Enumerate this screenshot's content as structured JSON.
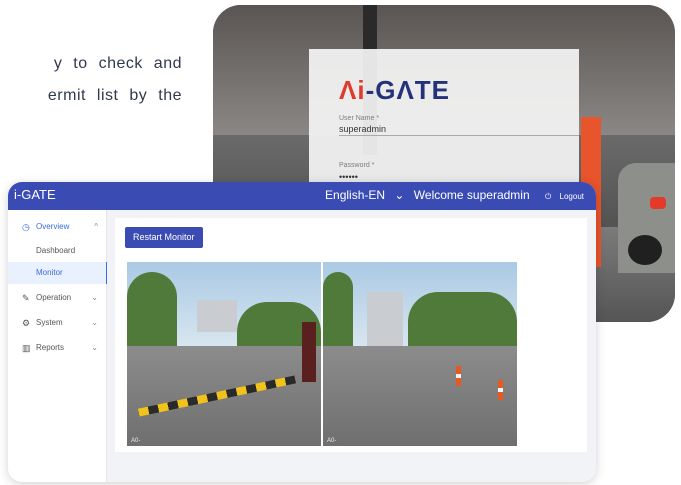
{
  "promo": {
    "line1": "y to check and",
    "line2": "ermit list by the"
  },
  "login": {
    "logo_a": "Λi",
    "logo_rest": "-GΛTE",
    "user_label": "User Name *",
    "user_value": "superadmin",
    "pass_label": "Password *",
    "pass_value": "••••••"
  },
  "topbar": {
    "brand": "i-GATE",
    "language": "English-EN",
    "language_chevron": "⌄",
    "welcome": "Welcome superadmin",
    "logout": "Logout"
  },
  "sidebar": {
    "items": [
      {
        "label": "Overview",
        "icon": "overview-icon",
        "chevron": "^"
      },
      {
        "label": "Dashboard"
      },
      {
        "label": "Monitor"
      },
      {
        "label": "Operation",
        "icon": "operation-icon",
        "chevron": "⌄"
      },
      {
        "label": "System",
        "icon": "system-icon",
        "chevron": "⌄"
      },
      {
        "label": "Reports",
        "icon": "reports-icon",
        "chevron": "⌄"
      }
    ]
  },
  "main": {
    "restart_label": "Restart Monitor",
    "cam1_osd": "A0-",
    "cam2_osd": "A0-"
  },
  "colors": {
    "brand_blue": "#3a4cb3",
    "active_blue": "#3a6be0",
    "logo_red": "#e03a2c"
  }
}
